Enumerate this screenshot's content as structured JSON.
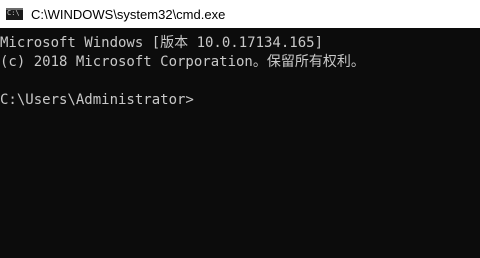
{
  "window": {
    "title": "C:\\WINDOWS\\system32\\cmd.exe",
    "icon": "cmd-icon",
    "icon_glyph": "C:\\"
  },
  "console": {
    "lines": [
      "Microsoft Windows [版本 10.0.17134.165]",
      "(c) 2018 Microsoft Corporation。保留所有权利。",
      "",
      "C:\\Users\\Administrator>"
    ]
  },
  "colors": {
    "console_background": "#0c0c0c",
    "console_text": "#c8c8c8",
    "titlebar_background": "#ffffff"
  }
}
